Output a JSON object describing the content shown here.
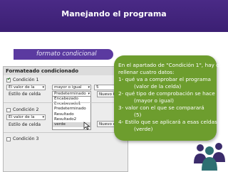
{
  "header": {
    "title": "Manejando el programa",
    "color": "#3b1f73"
  },
  "banner": {
    "label": "formato condicional"
  },
  "dialog": {
    "title": "Formateado condicionado",
    "condition1": {
      "label": "Condición 1",
      "checked": true
    },
    "cond1_mode": "El valor de la",
    "cond1_operator": "mayor o igual",
    "cond1_value": "5",
    "style_label": "Estilo de celda",
    "style_value": "Predeterminado",
    "new_style_button": "Nuevo Estilo",
    "style_options": [
      "Encabezado",
      "Encabezado1",
      "Predeterminado",
      "Resultado",
      "Resultado2",
      "verde"
    ],
    "style_selected": "verde",
    "condition2": {
      "label": "Condición 2",
      "checked": false
    },
    "cond2_mode": "El valor de la",
    "style2_label": "Estilo de celda",
    "new_style2_button": "Nuevo esti",
    "condition3": {
      "label": "Condición 3"
    }
  },
  "callout": {
    "color": "#6d9d2e",
    "lines": [
      "En el apartado de \"Condición 1\", hay que",
      "rellenar cuatro datos:",
      "1- qué va a comprobar el programa",
      "(valor de la celda)",
      "2- qué tipo de comprobación se hace",
      "(mayor o igual)",
      "3- valor con el que se comparará",
      "(5)",
      "4- Estilo que se aplicará a esas celdas",
      "(verde)"
    ]
  }
}
